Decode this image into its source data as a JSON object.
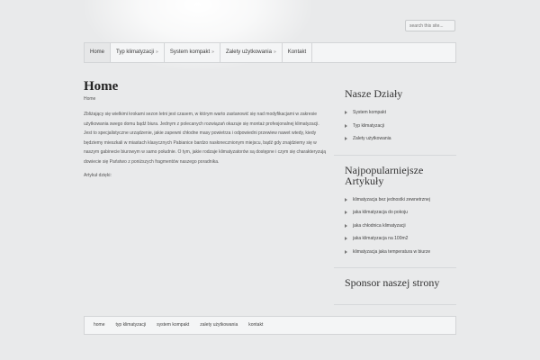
{
  "search": {
    "placeholder": "search this site..."
  },
  "nav": {
    "items": [
      {
        "label": "Home",
        "has_arrow": false
      },
      {
        "label": "Typ klimatyzacji",
        "has_arrow": true
      },
      {
        "label": "System kompakt",
        "has_arrow": true
      },
      {
        "label": "Zalety użytkowania",
        "has_arrow": true
      },
      {
        "label": "Kontakt",
        "has_arrow": false
      }
    ],
    "arrow_glyph": "»"
  },
  "main": {
    "title": "Home",
    "breadcrumb": "Home",
    "paragraphs": [
      "Zbliżający się wielkimi krokami sezon letni jest czasem, w którym warto zastanowić się nad modyfikacjami w zakresie użytkowania swego domu bądź biura. Jednym z polecanych rozwiązań okazuje się montaż profesjonalnej klimatyzacji. Jest to specjalistyczne urządzenie, jakie zapewni chłodne masy powietrza i odpowiedni przewiew nawet wtedy, kiedy będziemy mieszkali w miastach klasycznych Pabianice bardzo nasłonecznionym miejscu, bądź gdy znajdziemy się w naszym gabinecie biurowym w samo południe. O tym, jakie rodzaje klimatyzatorów są dostępne i czym się charakteryzują dowiecie się Państwo z poniższych fragmentów naszego poradnika.",
      "Artykuł dzięki:"
    ]
  },
  "sidebar": {
    "widgets": [
      {
        "title": "Nasze Działy",
        "items": [
          "System kompakt",
          "Typ klimatyzacji",
          "Zalety użytkowania"
        ]
      },
      {
        "title": "Najpopularniejsze Artykuły",
        "items": [
          "klimatyzacja bez jednostki zewnetrznej",
          "jaka klimatyzacja do pokoju",
          "jaka chłodnica klimatyzacji",
          "jaka klimatyzacja na 100m2",
          "klimatyzacja jaka temperatura w biurze"
        ]
      },
      {
        "title": "Sponsor naszej strony",
        "items": []
      }
    ]
  },
  "footer": {
    "items": [
      "home",
      "typ klimatyzacji",
      "system kompakt",
      "zalety użytkowania",
      "kontakt"
    ]
  }
}
